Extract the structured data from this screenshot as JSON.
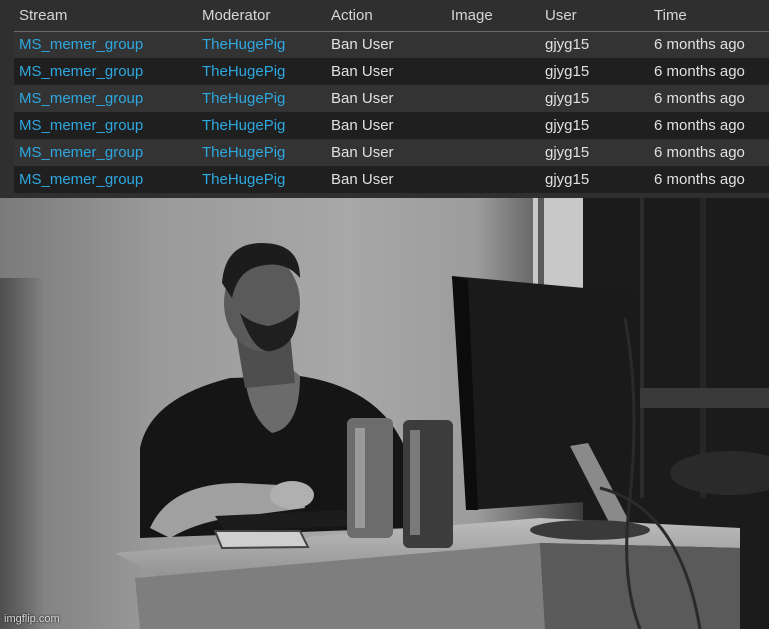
{
  "table": {
    "columns": [
      "Stream",
      "Moderator",
      "Action",
      "Image",
      "User",
      "Time"
    ],
    "rows": [
      {
        "stream": "MS_memer_group",
        "moderator": "TheHugePig",
        "action": "Ban User",
        "image": "",
        "user": "gjyg15",
        "time": "6 months ago"
      },
      {
        "stream": "MS_memer_group",
        "moderator": "TheHugePig",
        "action": "Ban User",
        "image": "",
        "user": "gjyg15",
        "time": "6 months ago"
      },
      {
        "stream": "MS_memer_group",
        "moderator": "TheHugePig",
        "action": "Ban User",
        "image": "",
        "user": "gjyg15",
        "time": "6 months ago"
      },
      {
        "stream": "MS_memer_group",
        "moderator": "TheHugePig",
        "action": "Ban User",
        "image": "",
        "user": "gjyg15",
        "time": "6 months ago"
      },
      {
        "stream": "MS_memer_group",
        "moderator": "TheHugePig",
        "action": "Ban User",
        "image": "",
        "user": "gjyg15",
        "time": "6 months ago"
      },
      {
        "stream": "MS_memer_group",
        "moderator": "TheHugePig",
        "action": "Ban User",
        "image": "",
        "user": "gjyg15",
        "time": "6 months ago"
      }
    ]
  },
  "colors": {
    "link": "#2ea8e0",
    "row_odd": "#333333",
    "row_even": "#1f1f1f",
    "header_bg": "#2f2f2f"
  },
  "photo": {
    "description": "Black-and-white photo of a bearded muscular man sitting at a desk using a computer with two cans beside the monitor",
    "watermark": "imgflip.com"
  }
}
